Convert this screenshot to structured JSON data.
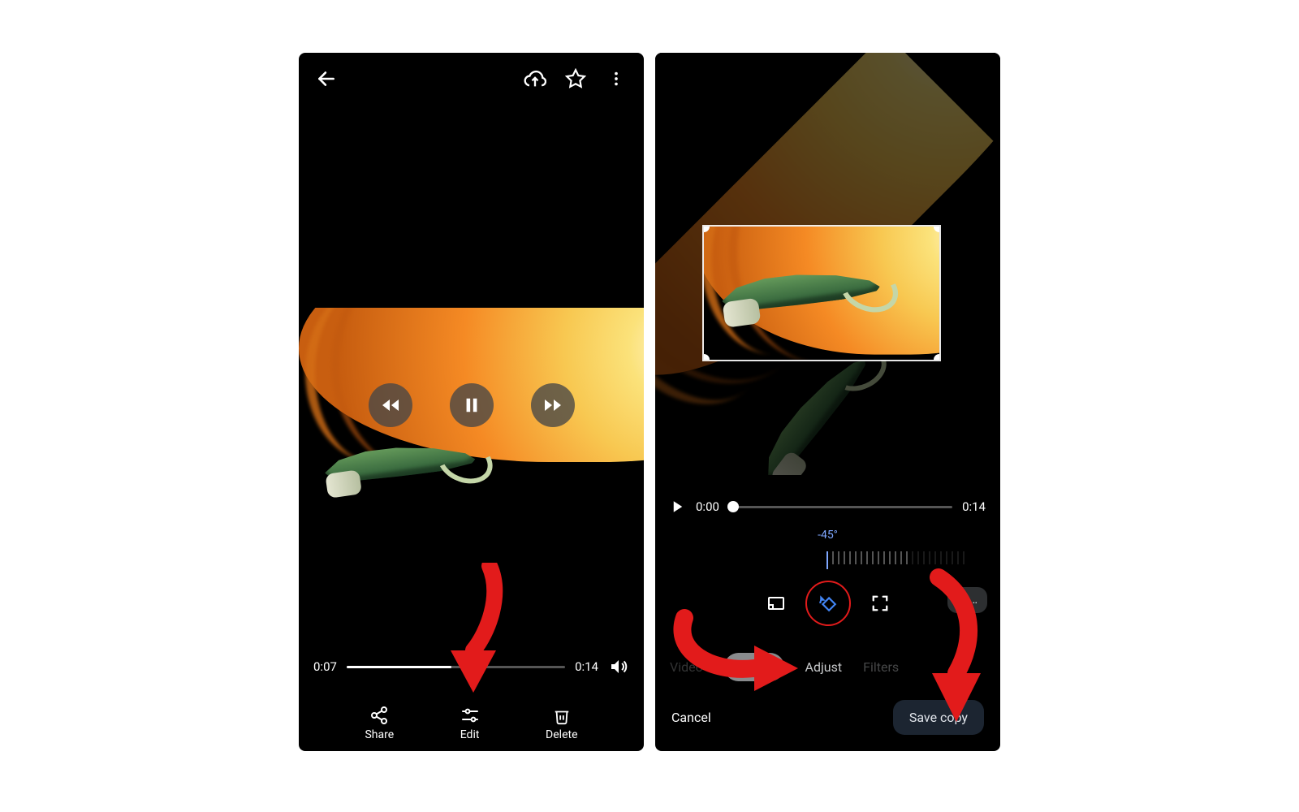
{
  "left": {
    "topbar": {
      "back_icon": "arrow-left",
      "cloud_icon": "cloud-upload",
      "star_icon": "star-outline",
      "menu_icon": "more-vert"
    },
    "playback": {
      "rewind_icon": "rewind",
      "pause_icon": "pause",
      "forward_icon": "fast-forward"
    },
    "time_current": "0:07",
    "time_total": "0:14",
    "volume_icon": "volume-up",
    "scrubber_progress_pct": 48,
    "actions": {
      "share": {
        "label": "Share",
        "icon": "share"
      },
      "edit": {
        "label": "Edit",
        "icon": "tune"
      },
      "delete": {
        "label": "Delete",
        "icon": "trash"
      }
    }
  },
  "right": {
    "play_icon": "play",
    "time_current": "0:00",
    "time_total": "0:14",
    "scrubber_progress_pct": 2,
    "rotation_angle_label": "-45°",
    "tools": {
      "aspect_icon": "aspect-ratio",
      "rotate_icon": "rotate-ccw",
      "expand_icon": "fullscreen"
    },
    "reset_label": "Re…",
    "tabs": {
      "video": "Video",
      "crop": "Crop",
      "adjust": "Adjust",
      "filters": "Filters"
    },
    "cancel_label": "Cancel",
    "save_label": "Save copy"
  },
  "annotations": {
    "arrow_points_to_edit": true,
    "arrow_points_to_crop": true,
    "arrow_points_to_save": true,
    "circle_around_rotate": true
  }
}
